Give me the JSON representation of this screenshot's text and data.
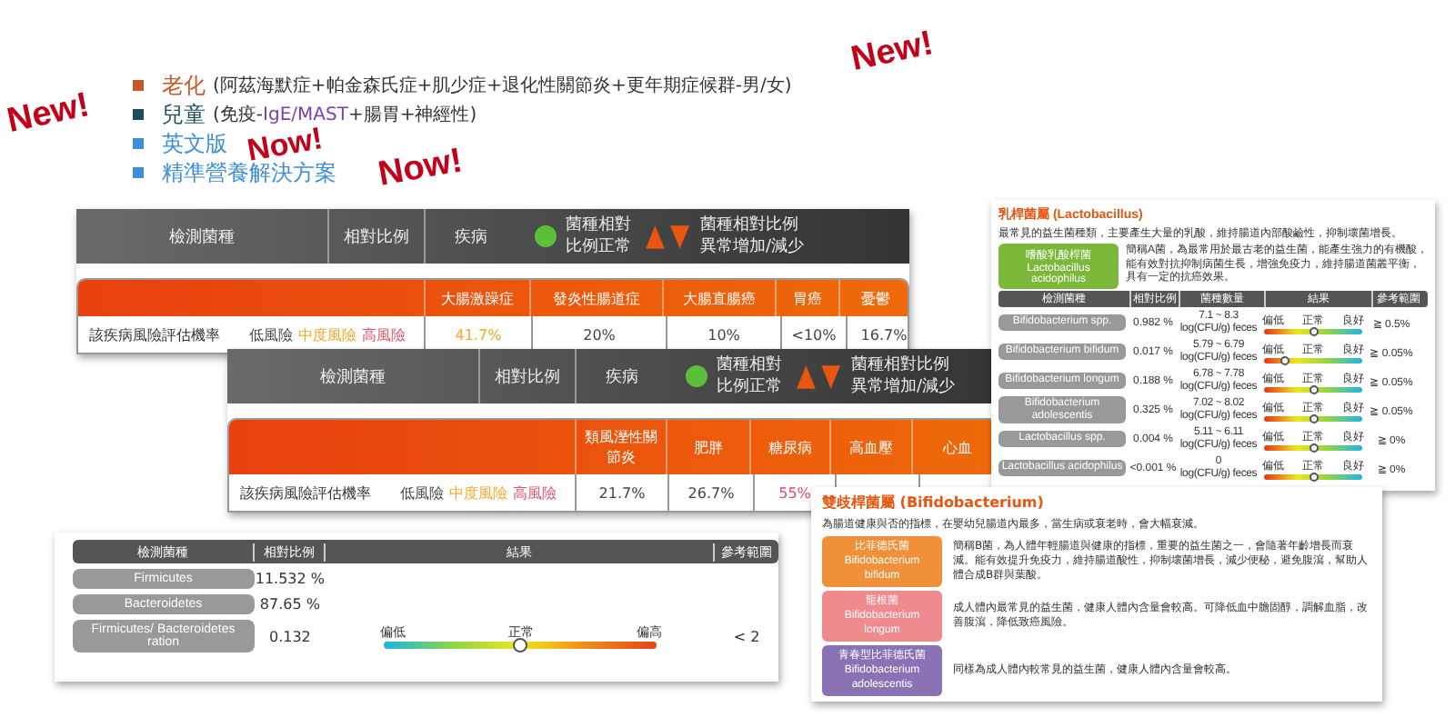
{
  "features": [
    {
      "label": "老化",
      "color": "#c8572a",
      "detail": [
        {
          "text": "(阿茲海默症+帕金森氏症+肌少症+退化性關節炎+更年期症候群-男/女)",
          "highlight": false
        }
      ]
    },
    {
      "label": "兒童",
      "color": "#1d4e5f",
      "detail": [
        {
          "text": "(免疫-",
          "highlight": false
        },
        {
          "text": "IgE/MAST",
          "highlight": true
        },
        {
          "text": "+腸胃+神經性)",
          "highlight": false
        }
      ]
    },
    {
      "label": "英文版",
      "color": "#3a8fd8"
    },
    {
      "label": "精準營養解決方案",
      "color": "#3a8fd8"
    }
  ],
  "stickers": [
    "New!",
    "New!",
    "Now!",
    "Now!"
  ],
  "risk_tables": [
    {
      "columns": [
        "檢測菌種",
        "相對比例",
        "疾病"
      ],
      "legend_normal": "菌種相對比例正常",
      "legend_abnormal": "菌種相對比例異常增加/減少",
      "row_label": "該疾病風險評估機率",
      "levels": [
        {
          "text": "低風險",
          "color": "#444444"
        },
        {
          "text": "中度風險",
          "color": "#f5a623"
        },
        {
          "text": "高風險",
          "color": "#e0506a"
        }
      ],
      "diseases": [
        {
          "name": "大腸激躁症",
          "value": "41.7%",
          "color": "#f5a623"
        },
        {
          "name": "發炎性腸道症",
          "value": "20%",
          "color": "#444444"
        },
        {
          "name": "大腸直腸癌",
          "value": "10%",
          "color": "#444444"
        },
        {
          "name": "胃癌",
          "value": "<10%",
          "color": "#444444"
        },
        {
          "name": "憂鬱",
          "value": "16.7%",
          "color": "#444444"
        }
      ]
    },
    {
      "columns": [
        "檢測菌種",
        "相對比例",
        "疾病"
      ],
      "legend_normal": "菌種相對比例正常",
      "legend_abnormal": "菌種相對比例異常增加/減少",
      "row_label": "該疾病風險評估機率",
      "levels": [
        {
          "text": "低風險",
          "color": "#444444"
        },
        {
          "text": "中度風險",
          "color": "#f5a623"
        },
        {
          "text": "高風險",
          "color": "#e0506a"
        }
      ],
      "diseases": [
        {
          "name": "類風溼性關節炎",
          "value": "21.7%",
          "color": "#444444"
        },
        {
          "name": "肥胖",
          "value": "26.7%",
          "color": "#444444"
        },
        {
          "name": "糖尿病",
          "value": "55%",
          "color": "#e0506a"
        },
        {
          "name": "高血壓"
        },
        {
          "name": "心血"
        }
      ]
    }
  ],
  "ratio_table": {
    "columns": [
      "檢測菌種",
      "相對比例",
      "結果",
      "參考範圍"
    ],
    "rows": [
      {
        "name": "Firmicutes",
        "value": "11.532 %"
      },
      {
        "name": "Bacteroidetes",
        "value": "87.65 %"
      },
      {
        "name": "Firmicutes/ Bacteroidetes ration",
        "value": "0.132",
        "scale": [
          "偏低",
          "正常",
          "偏高"
        ],
        "level": 0.5,
        "reference": "< 2"
      }
    ]
  },
  "lactobacillus": {
    "title": "乳桿菌屬 (Lactobacillus)",
    "description": "最常見的益生菌種類，主要產生大量的乳酸，維持腸道內部酸鹼性，抑制壞菌增長。",
    "strain": {
      "name": "嗜酸乳酸桿菌",
      "latin": "Lactobacillus acidophilus",
      "description": "簡稱A菌，為最常用於最古老的益生菌，能產生強力的有機酸，能有效對抗抑制病菌生長，增強免疫力，維持腸道菌叢平衡，具有一定的抗癌效果。"
    },
    "columns": [
      "檢測菌種",
      "相對比例",
      "菌種數量",
      "結果",
      "參考範圍"
    ],
    "rows": [
      {
        "name": "Bifidobacterium spp.",
        "ratio": "0.982 %",
        "count": "7.1 ~ 8.3",
        "unit": "log(CFU/g) feces",
        "scale": [
          "偏低",
          "正常",
          "良好"
        ],
        "level": 0.5,
        "reference": "≧ 0.5%"
      },
      {
        "name": "Bifidobacterium bifidum",
        "ratio": "0.017 %",
        "count": "5.79 ~ 6.79",
        "unit": "log(CFU/g) feces",
        "scale": [
          "偏低",
          "正常",
          "良好"
        ],
        "level": 0.2,
        "reference": "≧ 0.05%"
      },
      {
        "name": "Bifidobacterium longum",
        "ratio": "0.188 %",
        "count": "6.78 ~ 7.78",
        "unit": "log(CFU/g) feces",
        "scale": [
          "偏低",
          "正常",
          "良好"
        ],
        "level": 0.5,
        "reference": "≧ 0.05%"
      },
      {
        "name": "Bifidobacterium adolescentis",
        "ratio": "0.325 %",
        "count": "7.02 ~ 8.02",
        "unit": "log(CFU/g) feces",
        "scale": [
          "偏低",
          "正常",
          "良好"
        ],
        "level": 0.5,
        "reference": "≧ 0.05%"
      },
      {
        "name": "Lactobacillus spp.",
        "ratio": "0.004 %",
        "count": "5.11 ~ 6.11",
        "unit": "log(CFU/g) feces",
        "scale": [
          "偏低",
          "正常",
          "良好"
        ],
        "level": 0.5,
        "reference": "≧ 0%"
      },
      {
        "name": "Lactobacillus acidophilus",
        "ratio": "<0.001 %",
        "count": "0",
        "unit": "log(CFU/g) feces",
        "scale": [
          "偏低",
          "正常",
          "良好"
        ],
        "level": 0.5,
        "reference": "≧ 0%"
      }
    ]
  },
  "bifidobacterium": {
    "title": "雙歧桿菌屬 (Bifidobacterium)",
    "description": "為腸道健康與否的指標，在嬰幼兒腸道內最多，當生病或衰老時，會大幅衰減。",
    "strains": [
      {
        "name": "比菲德氏菌",
        "latin": "Bifidobacterium bifidum",
        "color": "#f0913a",
        "description": "簡稱B菌，為人體年輕腸道與健康的指標，重要的益生菌之一，會隨著年齡增長而衰減。能有效提升免疫力，維持腸道酸性，抑制壞菌增長，減少便秘，避免腹瀉，幫助人體合成B群與葉酸。"
      },
      {
        "name": "龍根菌",
        "latin": "Bifidobacterium longum",
        "color": "#ef8a8f",
        "description": "成人體內最常見的益生菌，健康人體內含量會較高。可降低血中膽固醇，調解血脂，改善腹瀉，降低致癌風險。"
      },
      {
        "name": "青春型比菲德氏菌",
        "latin": "Bifidobacterium adolescentis",
        "color": "#8a72b5",
        "description": "同樣為成人體內較常見的益生菌，健康人體內含量會較高。"
      }
    ]
  }
}
